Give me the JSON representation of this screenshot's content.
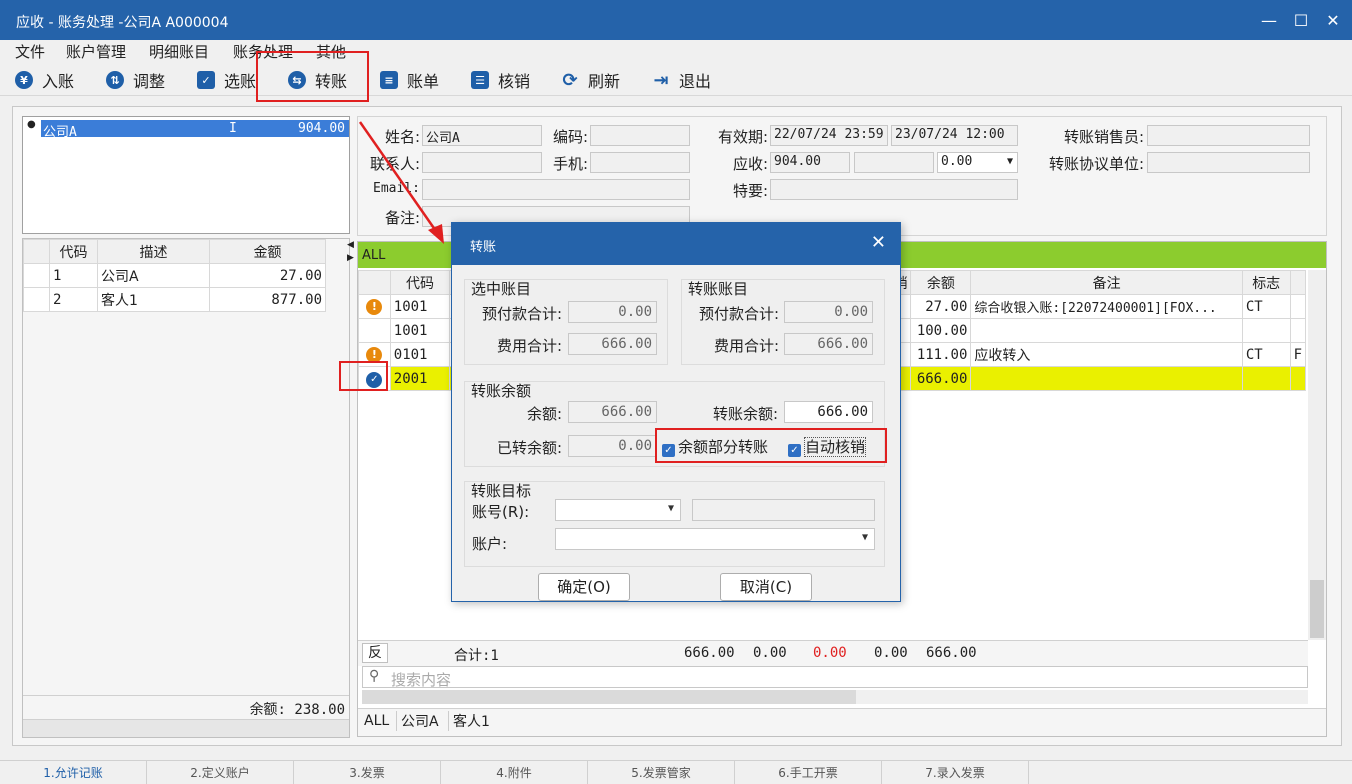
{
  "window": {
    "title": "应收 - 账务处理 -公司A  A000004"
  },
  "menu": [
    "文件",
    "账户管理",
    "明细账目",
    "账务处理",
    "其他"
  ],
  "toolbar": [
    {
      "label": "入账",
      "icon": "yen-icon"
    },
    {
      "label": "调整",
      "icon": "adjust-icon"
    },
    {
      "label": "选账",
      "icon": "select-icon"
    },
    {
      "label": "转账",
      "icon": "transfer-icon"
    },
    {
      "label": "账单",
      "icon": "bill-icon"
    },
    {
      "label": "核销",
      "icon": "writeoff-icon"
    },
    {
      "label": "刷新",
      "icon": "refresh-icon"
    },
    {
      "label": "退出",
      "icon": "exit-icon"
    }
  ],
  "customer": {
    "name": "公司A",
    "flag": "I",
    "amount": "904.00"
  },
  "left_grid": {
    "headers": [
      "代码",
      "描述",
      "金额"
    ],
    "rows": [
      {
        "code": "1",
        "desc": "公司A",
        "amount": "27.00"
      },
      {
        "code": "2",
        "desc": "客人1",
        "amount": "877.00"
      }
    ],
    "balance": "余额: 238.00"
  },
  "form": {
    "name_label": "姓名:",
    "name_value": "公司A",
    "code_label": "编码:",
    "valid_label": "有效期:",
    "valid_from": "22/07/24 23:59",
    "valid_to": "23/07/24 12:00",
    "sales_label": "转账销售员:",
    "contact_label": "联系人:",
    "mobile_label": "手机:",
    "ar_label": "应收:",
    "ar_value": "904.00",
    "ar_select": "0.00",
    "agreement_label": "转账协议单位:",
    "email_label": "Email:",
    "special_label": "特要:",
    "remark_label": "备注:"
  },
  "right_grid": {
    "filter": "ALL",
    "headers": {
      "code": "代码",
      "writeoff": "销",
      "balance": "余额",
      "remark": "备注",
      "flag": "标志"
    },
    "rows": [
      {
        "code": "1001",
        "balance": "27.00",
        "remark": "综合收银入账:[22072400001][FOX...",
        "flag": "CT",
        "extra": "",
        "status": "warning"
      },
      {
        "code": "1001",
        "balance": "100.00",
        "remark": "",
        "flag": "",
        "extra": "",
        "status": ""
      },
      {
        "code": "0101",
        "balance": "111.00",
        "remark": "应收转入",
        "flag": "CT",
        "extra": "F",
        "status": "warning"
      },
      {
        "code": "2001",
        "balance": "666.00",
        "remark": "",
        "flag": "",
        "extra": "",
        "status": "checked"
      }
    ],
    "footer": {
      "reverse": "反",
      "total": "合计:1",
      "v1": "666.00",
      "v2": "0.00",
      "v3": "0.00",
      "v4": "0.00",
      "v5": "666.00"
    },
    "search_placeholder": "搜索内容",
    "bottom_tabs": [
      "ALL",
      "公司A",
      "客人1"
    ]
  },
  "dialog": {
    "title": "转账",
    "selected": {
      "title": "选中账目",
      "prepay_label": "预付款合计:",
      "prepay": "0.00",
      "fee_label": "费用合计:",
      "fee": "666.00"
    },
    "target_acct": {
      "title": "转账账目",
      "prepay_label": "预付款合计:",
      "prepay": "0.00",
      "fee_label": "费用合计:",
      "fee": "666.00"
    },
    "balance": {
      "title": "转账余额",
      "bal_label": "余额:",
      "bal": "666.00",
      "transfer_label": "转账余额:",
      "transfer": "666.00",
      "done_label": "已转余额:",
      "done": "0.00",
      "partial": "余额部分转账",
      "auto": "自动核销"
    },
    "target": {
      "title": "转账目标",
      "acct_label": "账号(R):",
      "account_label": "账户:"
    },
    "ok": "确定(O)",
    "cancel": "取消(C)"
  },
  "statusbar": [
    "1.允许记账",
    "2.定义账户",
    "3.发票",
    "4.附件",
    "5.发票管家",
    "6.手工开票",
    "7.录入发票"
  ]
}
